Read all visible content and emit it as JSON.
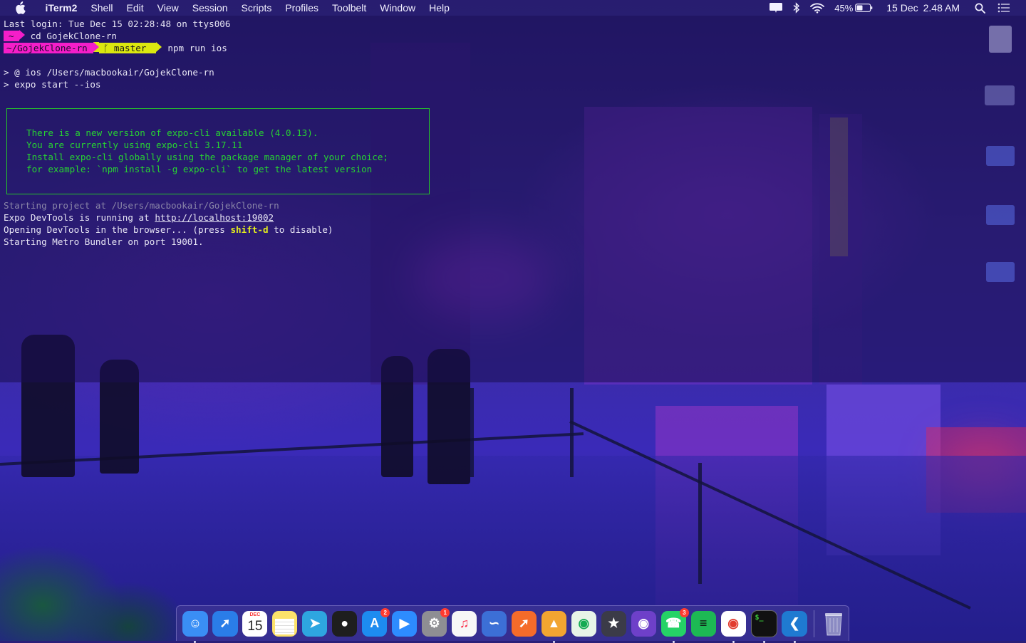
{
  "menubar": {
    "apple_icon": "apple-logo-icon",
    "app_name": "iTerm2",
    "menus": [
      "Shell",
      "Edit",
      "View",
      "Session",
      "Scripts",
      "Profiles",
      "Toolbelt",
      "Window",
      "Help"
    ],
    "battery_percent": "45%",
    "date": "15 Dec",
    "time": "2.48 AM",
    "status_icons": [
      "notification-icon",
      "bluetooth-icon",
      "wifi-icon",
      "battery-icon",
      "spotlight-search-icon",
      "notification-center-icon"
    ]
  },
  "terminal": {
    "last_login": "Last login: Tue Dec 15 02:28:48 on ttys006",
    "prompt1_dir": "~",
    "prompt1_cmd": "cd GojekClone-rn",
    "prompt2_dir": "~/GojekClone-rn",
    "prompt2_branch": "master",
    "prompt2_branch_icon": "git-branch-icon",
    "prompt2_cmd": "npm run ios",
    "script_line1": "> @ ios /Users/macbookair/GojekClone-rn",
    "script_line2": "> expo start --ios",
    "notice_lines": [
      "There is a new version of expo-cli available (4.0.13).",
      "You are currently using expo-cli 3.17.11",
      "Install expo-cli globally using the package manager of your choice;",
      "for example: `npm install -g expo-cli` to get the latest version"
    ],
    "starting_project": "Starting project at /Users/macbookair/GojekClone-rn",
    "devtools_prefix": "Expo DevTools is running at ",
    "devtools_url": "http://localhost:19002",
    "opening_prefix": "Opening DevTools in the browser... (press ",
    "opening_key": "shift-d",
    "opening_suffix": " to disable)",
    "metro": "Starting Metro Bundler on port 19001."
  },
  "dock": {
    "apps": [
      {
        "name": "Finder",
        "icon": "finder-icon",
        "color": "#3a8ef5",
        "running": true
      },
      {
        "name": "Safari",
        "icon": "safari-icon",
        "color": "#2a7de8",
        "running": false
      },
      {
        "name": "Calendar",
        "icon": "calendar-icon",
        "color": "#ffffff",
        "running": false,
        "month": "DEC",
        "day": "15"
      },
      {
        "name": "Notes",
        "icon": "notes-icon",
        "color": "#fce26b",
        "running": false
      },
      {
        "name": "Telegram",
        "icon": "telegram-icon",
        "color": "#2ea6e0",
        "running": false
      },
      {
        "name": "Figma",
        "icon": "figma-icon",
        "color": "#1e1e1e",
        "running": false
      },
      {
        "name": "App Store",
        "icon": "app-store-icon",
        "color": "#1d8cf0",
        "running": false,
        "badge": "2"
      },
      {
        "name": "Zoom",
        "icon": "zoom-icon",
        "color": "#2d8cff",
        "running": false
      },
      {
        "name": "System Preferences",
        "icon": "system-preferences-icon",
        "color": "#8e8e93",
        "running": false,
        "badge": "1"
      },
      {
        "name": "Music",
        "icon": "music-icon",
        "color": "#f7f7f7",
        "running": false
      },
      {
        "name": "Lasso",
        "icon": "lasso-icon",
        "color": "#3c6fd6",
        "running": false
      },
      {
        "name": "Postman",
        "icon": "postman-icon",
        "color": "#f56b2a",
        "running": false
      },
      {
        "name": "Transmit",
        "icon": "transmit-icon",
        "color": "#f2a531",
        "running": true
      },
      {
        "name": "MongoDB Compass",
        "icon": "mongodb-icon",
        "color": "#e8f4e8",
        "running": false
      },
      {
        "name": "TablePlus",
        "icon": "tableplus-icon",
        "color": "#3b3b48",
        "running": false
      },
      {
        "name": "GitHub Desktop",
        "icon": "github-icon",
        "color": "#6e40c9",
        "running": false
      },
      {
        "name": "WhatsApp",
        "icon": "whatsapp-icon",
        "color": "#25d366",
        "running": true,
        "badge": "3"
      },
      {
        "name": "Spotify",
        "icon": "spotify-icon",
        "color": "#1db954",
        "running": false
      },
      {
        "name": "Chrome",
        "icon": "chrome-icon",
        "color": "#ffffff",
        "running": true
      },
      {
        "name": "iTerm2",
        "icon": "iterm-icon",
        "color": "#111111",
        "running": true
      },
      {
        "name": "VS Code",
        "icon": "vscode-icon",
        "color": "#1f7ad1",
        "running": true
      }
    ],
    "trash": {
      "name": "Trash",
      "icon": "trash-icon"
    }
  }
}
